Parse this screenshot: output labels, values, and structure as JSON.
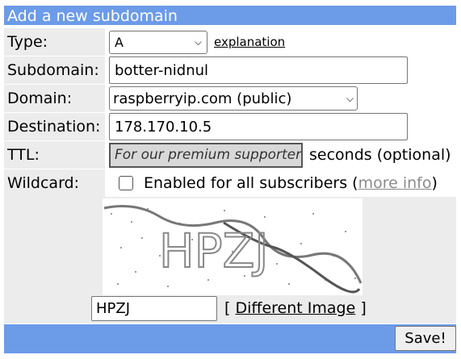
{
  "form": {
    "title": "Add a new subdomain",
    "type": {
      "label": "Type:",
      "value": "A",
      "explanation_link": "explanation"
    },
    "subdomain": {
      "label": "Subdomain:",
      "value": "botter-nidnul"
    },
    "domain": {
      "label": "Domain:",
      "value": "raspberryip.com (public)"
    },
    "destination": {
      "label": "Destination:",
      "value": "178.170.10.5"
    },
    "ttl": {
      "label": "TTL:",
      "placeholder": "For our premium supporters",
      "suffix": "seconds (optional)"
    },
    "wildcard": {
      "label": "Wildcard:",
      "text": "Enabled for all subscribers (",
      "link": "more info",
      "close": ")"
    },
    "captcha": {
      "image_text": "HPZJ",
      "value": "HPZJ",
      "different_open": "[",
      "different_link": "Different Image",
      "different_close": "]"
    },
    "save_label": "Save!"
  },
  "colors": {
    "header_bg": "#6c9be8",
    "label_bg": "#ececec"
  }
}
